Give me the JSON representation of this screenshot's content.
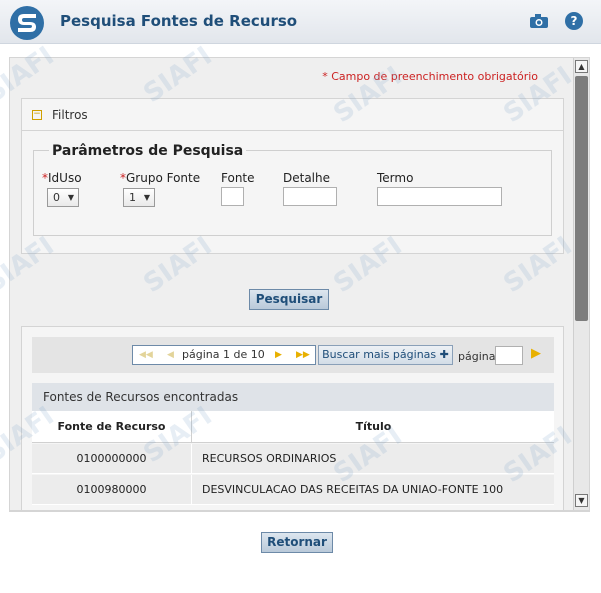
{
  "header": {
    "title": "Pesquisa Fontes de Recurso",
    "help_symbol": "?"
  },
  "form": {
    "required_note": "* Campo de preenchimento obrigatório",
    "filters": {
      "title": "Filtros",
      "collapse_symbol": "−"
    },
    "params": {
      "legend": "Parâmetros de Pesquisa",
      "required_mark": "*",
      "fields": {
        "iduso": {
          "label": "IdUso",
          "value": "0"
        },
        "grupo_fonte": {
          "label": "Grupo Fonte",
          "value": "1"
        },
        "fonte": {
          "label": "Fonte",
          "value": ""
        },
        "detalhe": {
          "label": "Detalhe",
          "value": ""
        },
        "termo": {
          "label": "Termo",
          "value": ""
        }
      }
    },
    "search_button": "Pesquisar"
  },
  "results": {
    "pager": {
      "text": "página 1 de 10",
      "more_pages_button": "Buscar mais páginas ✚",
      "page_label": "página",
      "page_value": ""
    },
    "title": "Fontes de Recursos encontradas",
    "columns": [
      "Fonte de Recurso",
      "Título"
    ],
    "rows": [
      [
        "0100000000",
        "RECURSOS ORDINARIOS"
      ],
      [
        "0100980000",
        "DESVINCULACAO DAS RECEITAS DA UNIAO-FONTE 100"
      ]
    ]
  },
  "footer": {
    "back_button": "Retornar"
  },
  "icons": {
    "logo": "siafi-logo-icon",
    "camera": "camera-icon",
    "help": "help-icon"
  },
  "colors": {
    "title": "#1f4e79",
    "required": "#cc2222",
    "accent": "#e8b000"
  }
}
